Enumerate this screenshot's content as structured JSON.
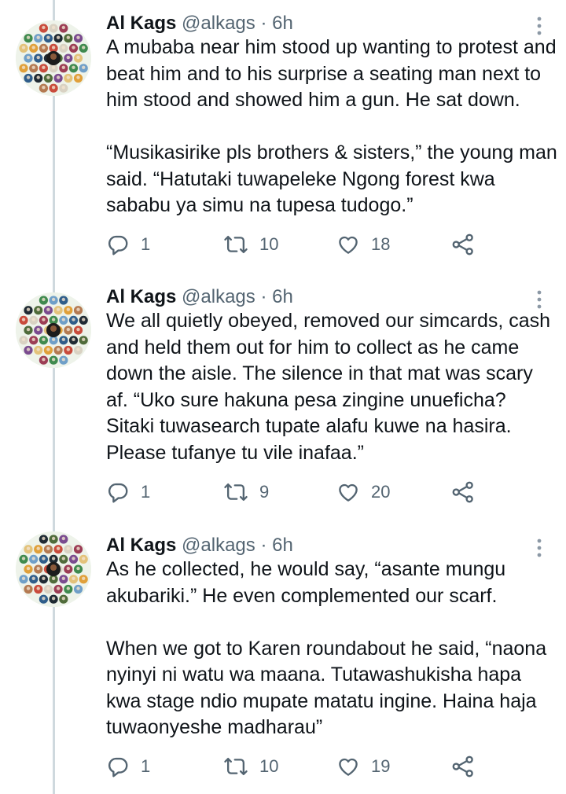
{
  "tweets": [
    {
      "name": "Al Kags",
      "handle": "@alkags",
      "separator": "·",
      "time": "6h",
      "paragraphs": [
        "A mubaba near him stood up wanting to protest and beat him and to his surprise a seating man next to him stood and showed him a gun. He sat down.",
        "“Musikasirike pls brothers & sisters,” the young man said. “Hatutaki tuwapeleke Ngong forest kwa sababu ya simu na tupesa tudogo.”"
      ],
      "replies": "1",
      "retweets": "10",
      "likes": "18"
    },
    {
      "name": "Al Kags",
      "handle": "@alkags",
      "separator": "·",
      "time": "6h",
      "paragraphs": [
        "We all quietly obeyed, removed our simcards, cash and held them out for him to collect as he came down the aisle. The silence in that mat was scary af. “Uko sure hakuna pesa zingine unueficha? Sitaki tuwasearch tupate alafu kuwe na hasira. Please tufanye tu vile inafaa.”"
      ],
      "replies": "1",
      "retweets": "9",
      "likes": "20"
    },
    {
      "name": "Al Kags",
      "handle": "@alkags",
      "separator": "·",
      "time": "6h",
      "paragraphs": [
        "As he collected, he would say, “asante mungu akubariki.” He even complemented our scarf.",
        "When we got to Karen roundabout he said, “naona nyinyi ni watu wa maana. Tutawashukisha hapa kwa stage ndio mupate matatu ingine. Haina haja tuwaonyeshe madharau”"
      ],
      "replies": "1",
      "retweets": "10",
      "likes": "19"
    }
  ],
  "icons": {
    "reply": "speech-bubble-icon",
    "retweet": "retweet-arrows-icon",
    "like": "heart-outline-icon",
    "share": "share-nodes-icon",
    "more": "vertical-ellipsis-icon"
  },
  "colors": {
    "text": "#0f1419",
    "secondary": "#536471",
    "thread_line": "#cfd9de"
  }
}
